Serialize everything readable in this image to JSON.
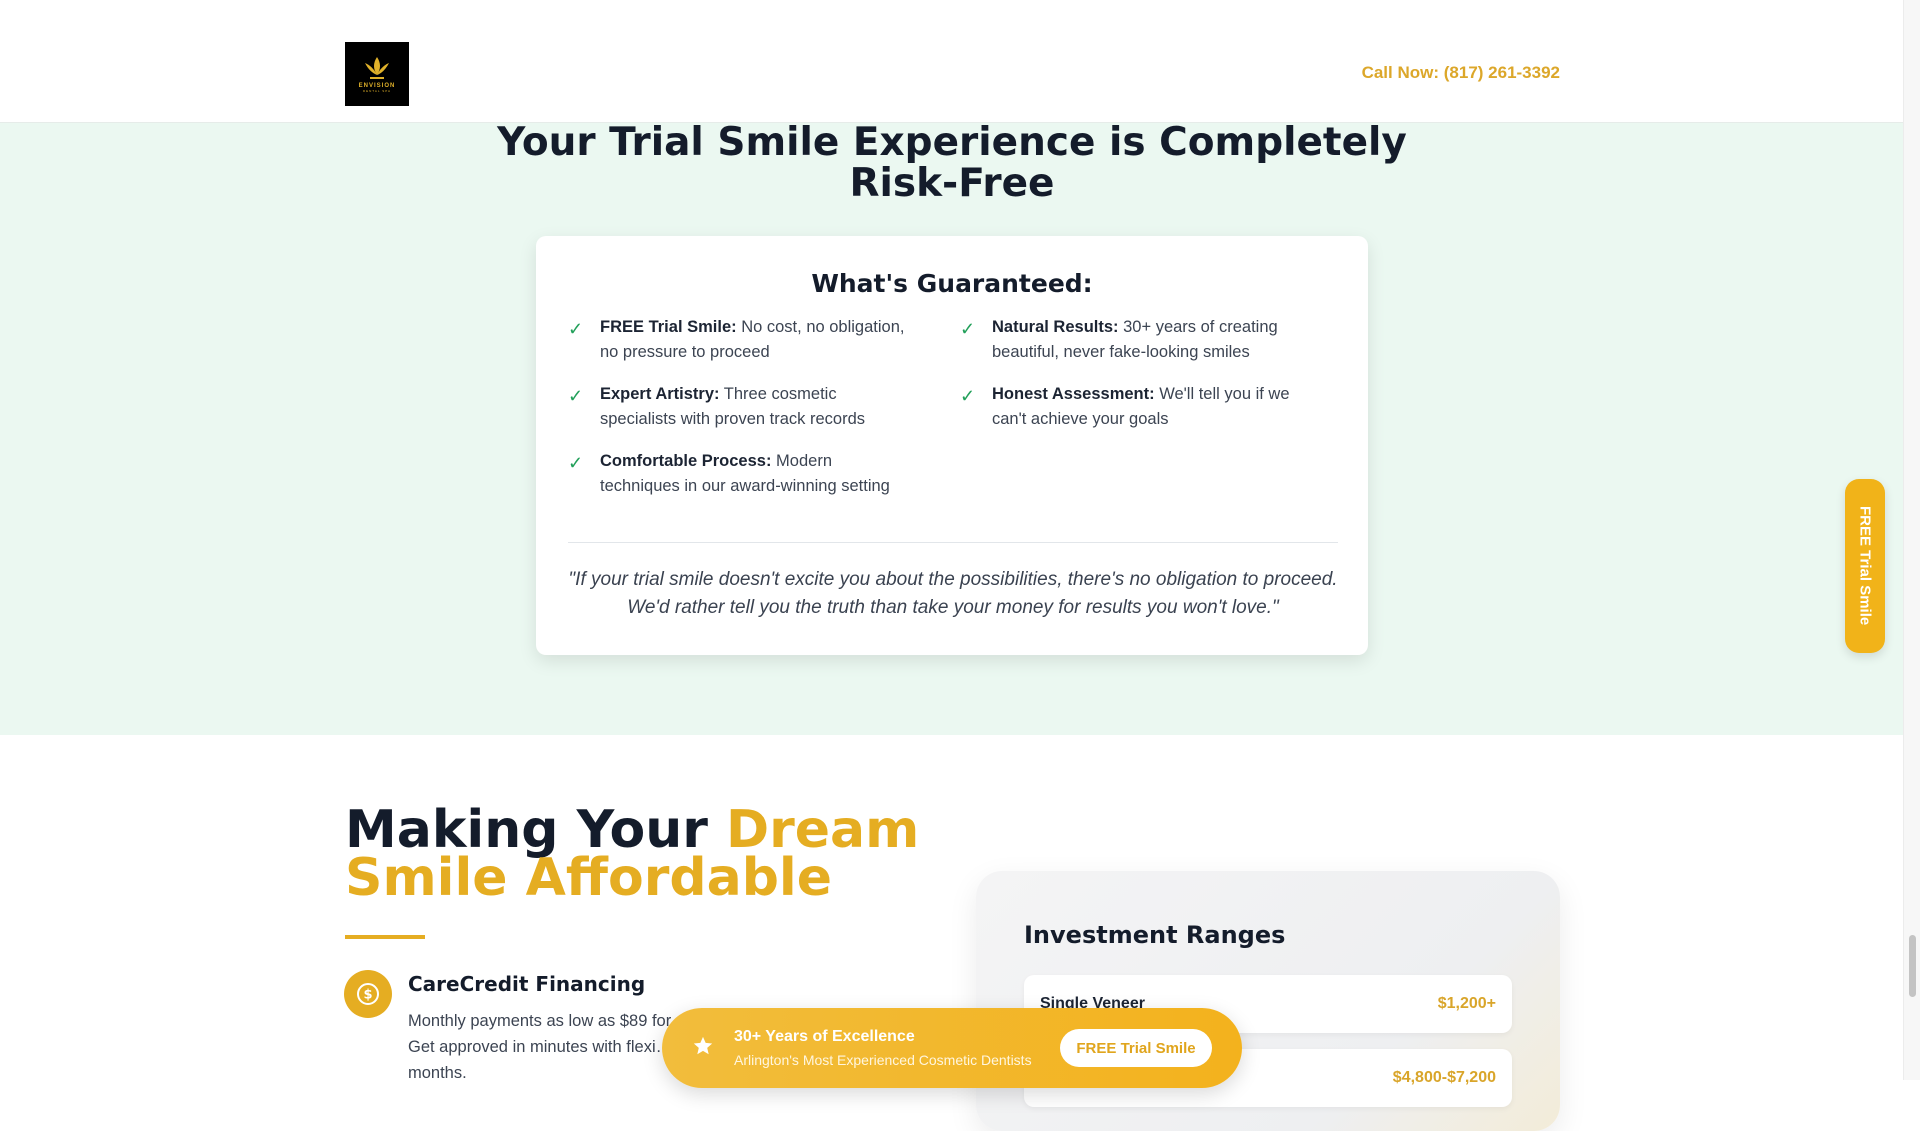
{
  "header": {
    "logo_text": "ENVISION",
    "logo_sub": "DENTAL SPA",
    "call_label": "Call Now: (817) 261-3392"
  },
  "guarantee": {
    "title_line1": "Your Trial Smile Experience is Completely",
    "title_line2": "Risk-Free",
    "card_title": "What's Guaranteed:",
    "items": [
      {
        "bold": "FREE Trial Smile:",
        "text": " No cost, no obligation, no pressure to proceed"
      },
      {
        "bold": "Natural Results:",
        "text": " 30+ years of creating beautiful, never fake-looking smiles"
      },
      {
        "bold": "Expert Artistry:",
        "text": " Three cosmetic specialists with proven track records"
      },
      {
        "bold": "Honest Assessment:",
        "text": " We'll tell you if we can't achieve your goals"
      },
      {
        "bold": "Comfortable Process:",
        "text": " Modern techniques in our award-winning setting"
      }
    ],
    "quote": "\"If your trial smile doesn't excite you about the possibilities, there's no obligation to proceed. We'd rather tell you the truth than take your money for results you won't love.\""
  },
  "side_tab": {
    "label": "FREE Trial Smile"
  },
  "financing": {
    "title_part1": "Making Your ",
    "title_accent1": "Dream",
    "title_accent2": "Smile Affordable",
    "carecredit_title": "CareCredit Financing",
    "carecredit_text": "Monthly payments as low as $89 for… Get approved in minutes with flexi… months."
  },
  "investment": {
    "title": "Investment Ranges",
    "rows": [
      {
        "name": "Single Veneer",
        "price": "$1,200+"
      },
      {
        "name": "",
        "price": "$4,800-$7,200"
      }
    ]
  },
  "float_bar": {
    "title": "30+ Years of Excellence",
    "subtitle": "Arlington's Most Experienced Cosmetic Dentists",
    "button": "FREE Trial Smile"
  },
  "colors": {
    "accent": "#e5ad22",
    "section_bg": "#ebf8f1",
    "check": "#22a05a"
  }
}
